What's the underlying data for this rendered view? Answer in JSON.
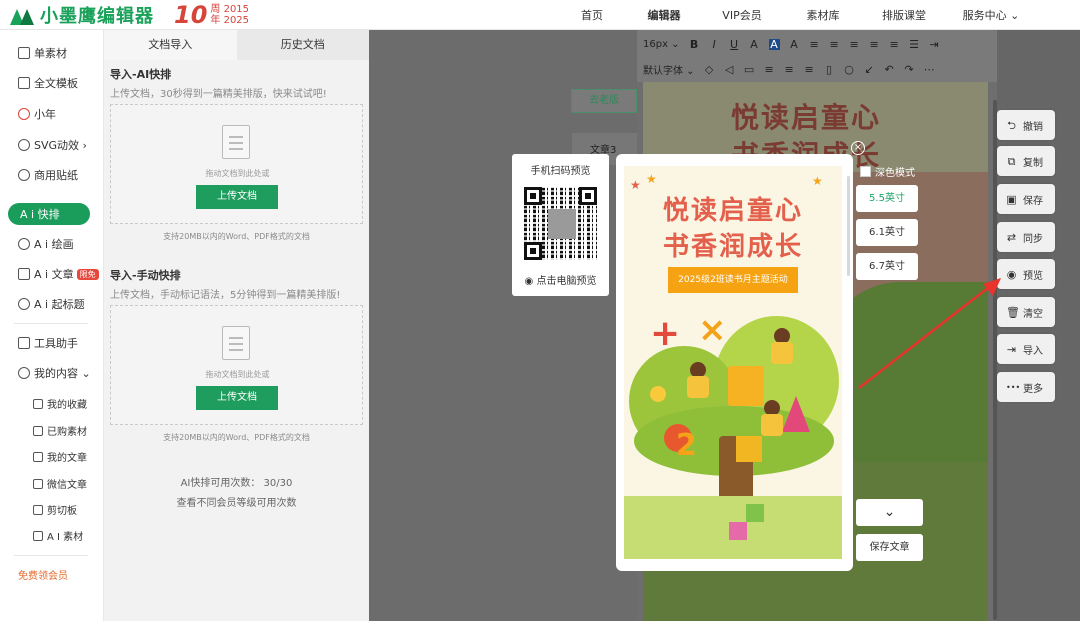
{
  "header": {
    "logo_text": "小墨鹰编辑器",
    "anniversary": {
      "number": "10",
      "line1": "周 2015",
      "line2": "年 2025"
    },
    "nav": [
      "首页",
      "编辑器",
      "VIP会员",
      "素材库",
      "排版课堂",
      "服务中心 ⌄"
    ]
  },
  "sidebar": {
    "items": [
      "单素材",
      "全文模板",
      "小年",
      "SVG动效 ›",
      "商用贴纸",
      "A i 快排",
      "A i 绘画",
      "A i 文章",
      "A i 起标题",
      "工具助手",
      "我的内容 ⌄"
    ],
    "ai_article_badge": "限免",
    "sub_items": [
      "我的收藏",
      "已购素材",
      "我的文章",
      "微信文章",
      "剪切板",
      "A I 素材"
    ],
    "free_vip": "免费领会员"
  },
  "import_panel": {
    "tabs": [
      "文档导入",
      "历史文档"
    ],
    "ai_section": {
      "title": "导入-AI快排",
      "desc": "上传文档，30秒得到一篇精美排版，快来试试吧!",
      "drop_hint": "拖动文档到此处或",
      "upload_label": "上传文档",
      "support": "支持20MB以内的Word、PDF格式的文档"
    },
    "manual_section": {
      "title": "导入-手动快排",
      "desc": "上传文档，手动标记语法，5分钟得到一篇精美排版!",
      "drop_hint": "拖动文档到此处或",
      "upload_label": "上传文档",
      "support": "支持20MB以内的Word、PDF格式的文档"
    },
    "quota_line": "AI快排可用次数：  30/30",
    "quota_sub": "查看不同会员等级可用次数"
  },
  "editor": {
    "old_version_btn": "去老版",
    "draft_label": "文章3",
    "font_size": "16px ⌄",
    "font_family": "默认字体 ⌄",
    "article_title_1": "悦读启童心",
    "article_title_2": "书香润成长"
  },
  "right_bar": {
    "buttons": [
      {
        "label": "撤销",
        "icon": "undo-icon",
        "glyph": "⮌"
      },
      {
        "label": "复制",
        "icon": "copy-icon",
        "glyph": "⧉"
      },
      {
        "label": "保存",
        "icon": "save-icon",
        "glyph": "▣"
      },
      {
        "label": "同步",
        "icon": "sync-icon",
        "glyph": "⇄"
      },
      {
        "label": "预览",
        "icon": "eye-icon",
        "glyph": "◉"
      },
      {
        "label": "清空",
        "icon": "trash-icon",
        "glyph": "🗑"
      },
      {
        "label": "导入",
        "icon": "import-icon",
        "glyph": "⇥"
      },
      {
        "label": "更多",
        "icon": "more-icon",
        "glyph": "•••"
      }
    ]
  },
  "preview": {
    "qr_title": "手机扫码预览",
    "pc_preview": "点击电脑预览",
    "poster_title_1": "悦读启童心",
    "poster_title_2": "书香润成长",
    "poster_banner": "2025级2班读书月主题活动",
    "dark_mode_label": "深色模式",
    "sizes": [
      "5.5英寸",
      "6.1英寸",
      "6.7英寸"
    ],
    "active_size": "5.5英寸",
    "collapse": "⌄",
    "save_article": "保存文章"
  },
  "colors": {
    "brand_green": "#1a9c5b",
    "accent_red": "#e3604c",
    "arrow_red": "#e8342c"
  }
}
